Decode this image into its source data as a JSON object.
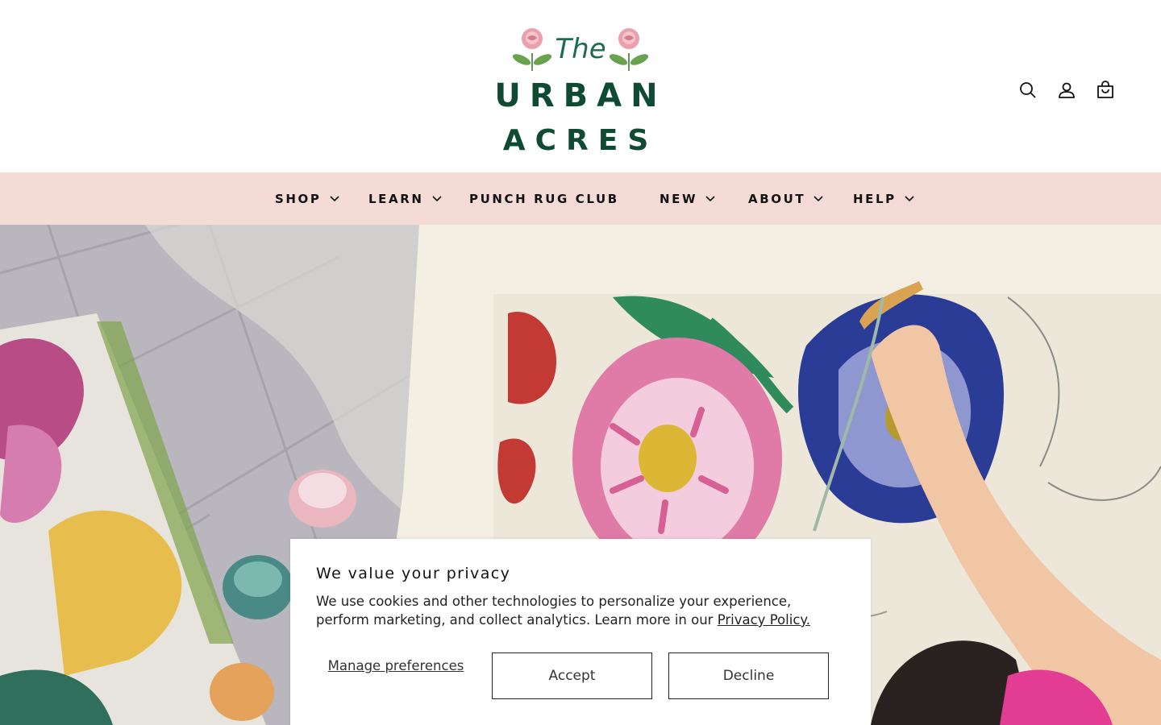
{
  "brand": {
    "logo_the": "The",
    "logo_urban": "URBAN",
    "logo_acres": "ACRES",
    "brand_green": "#0f4a33",
    "rose_pink": "#e89aa7",
    "leaf_green": "#5f9a4a"
  },
  "header": {
    "icons": [
      "search-icon",
      "account-icon",
      "cart-icon"
    ]
  },
  "nav": {
    "background": "#f5dbd5",
    "items": [
      {
        "label": "SHOP",
        "has_dropdown": true
      },
      {
        "label": "LEARN",
        "has_dropdown": true
      },
      {
        "label": "PUNCH RUG CLUB",
        "has_dropdown": false
      },
      {
        "label": "NEW",
        "has_dropdown": true
      },
      {
        "label": "ABOUT",
        "has_dropdown": true
      },
      {
        "label": "HELP",
        "has_dropdown": true
      }
    ]
  },
  "cookie": {
    "title": "We value your privacy",
    "text": "We use cookies and other technologies to personalize your experience, perform marketing, and collect analytics. Learn more in our ",
    "link": "Privacy Policy.",
    "manage_label": "Manage preferences",
    "accept_label": "Accept",
    "decline_label": "Decline"
  }
}
